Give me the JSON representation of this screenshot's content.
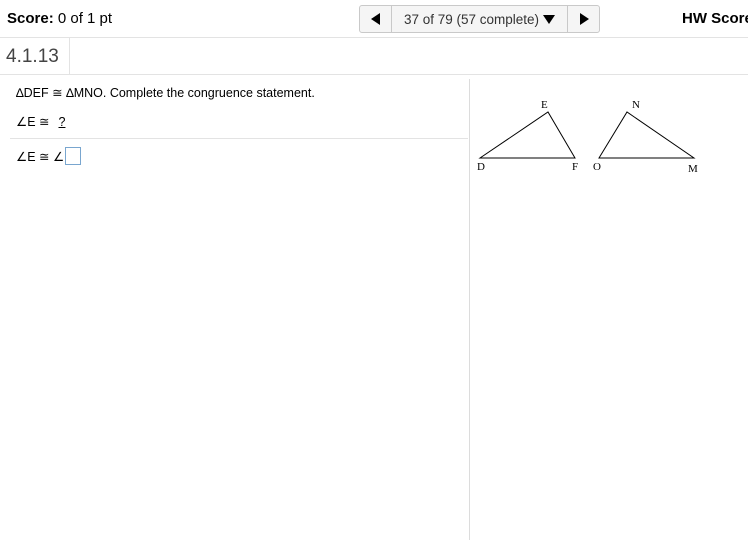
{
  "header": {
    "score_label": "Score:",
    "score_value": "0 of 1 pt",
    "progress": "37 of 79 (57 complete)",
    "hw_score_label": "HW Score"
  },
  "question": {
    "number": "4.1.13",
    "prompt": "∆DEF ≅ ∆MNO. Complete the congruence statement.",
    "given_left": "∠E ≅",
    "given_blank": "?",
    "answer_left": "∠E ≅ ∠",
    "answer_value": ""
  },
  "figure": {
    "triangle1_labels": [
      "D",
      "E",
      "F"
    ],
    "triangle2_labels": [
      "O",
      "N",
      "M"
    ]
  }
}
